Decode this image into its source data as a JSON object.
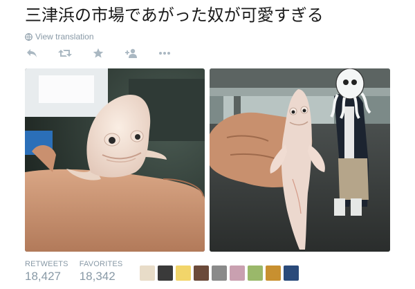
{
  "tweet": {
    "text": "三津浜の市場であがった奴が可愛すぎる",
    "view_translation": "View translation"
  },
  "actions": [
    {
      "icon": "reply-icon"
    },
    {
      "icon": "retweet-icon"
    },
    {
      "icon": "favorite-star-icon"
    },
    {
      "icon": "follow-icon"
    },
    {
      "icon": "more-icon"
    }
  ],
  "stats": {
    "retweets_label": "RETWEETS",
    "retweets_count": "18,427",
    "favorites_label": "FAVORITES",
    "favorites_count": "18,342"
  },
  "colors": {
    "muted_text": "#8899a6",
    "tweet_text": "#1a1a1a",
    "background": "#ffffff"
  },
  "favoriter_avatars": [
    {
      "color": "#e8dcc8"
    },
    {
      "color": "#3a3a3a"
    },
    {
      "color": "#f2d56a"
    },
    {
      "color": "#6b4a3a"
    },
    {
      "color": "#8a8a8a"
    },
    {
      "color": "#c9a0b0"
    },
    {
      "color": "#9ab86a"
    },
    {
      "color": "#c89030"
    },
    {
      "color": "#2a4a7a"
    }
  ]
}
